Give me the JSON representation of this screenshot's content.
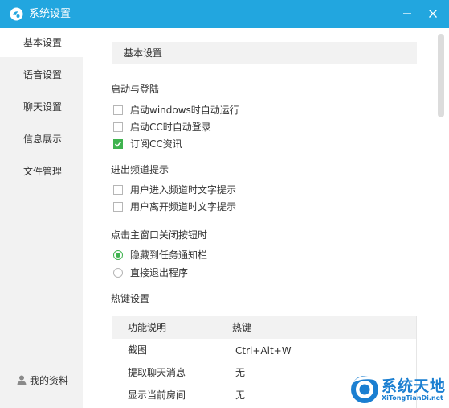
{
  "window": {
    "title": "系统设置",
    "accent_color": "#22a6df",
    "controls": [
      "minimize-icon",
      "close-icon"
    ]
  },
  "sidebar": {
    "items": [
      {
        "label": "基本设置",
        "active": true
      },
      {
        "label": "语音设置",
        "active": false
      },
      {
        "label": "聊天设置",
        "active": false
      },
      {
        "label": "信息展示",
        "active": false
      },
      {
        "label": "文件管理",
        "active": false
      }
    ],
    "profile_label": "我的资料",
    "profile_icon": "user-icon"
  },
  "main": {
    "section_title": "基本设置",
    "startup": {
      "title": "启动与登陆",
      "options": [
        {
          "label": "启动windows时自动运行",
          "checked": false
        },
        {
          "label": "启动CC时自动登录",
          "checked": false
        },
        {
          "label": "订阅CC资讯",
          "checked": true
        }
      ]
    },
    "channel_tips": {
      "title": "进出频道提示",
      "options": [
        {
          "label": "用户进入频道时文字提示",
          "checked": false
        },
        {
          "label": "用户离开频道时文字提示",
          "checked": false
        }
      ]
    },
    "close_behavior": {
      "title": "点击主窗口关闭按钮时",
      "options": [
        {
          "label": "隐藏到任务通知栏",
          "selected": true
        },
        {
          "label": "直接退出程序",
          "selected": false
        }
      ]
    },
    "hotkeys": {
      "title": "热键设置",
      "columns": [
        "功能说明",
        "热键"
      ],
      "rows": [
        {
          "function": "截图",
          "key": "Ctrl+Alt+W"
        },
        {
          "function": "提取聊天消息",
          "key": "无"
        },
        {
          "function": "显示当前房间",
          "key": "无"
        }
      ]
    },
    "check_color": "#3fb34f"
  },
  "watermark": {
    "name": "系统天地",
    "url": "XiTongTianDi.net"
  }
}
